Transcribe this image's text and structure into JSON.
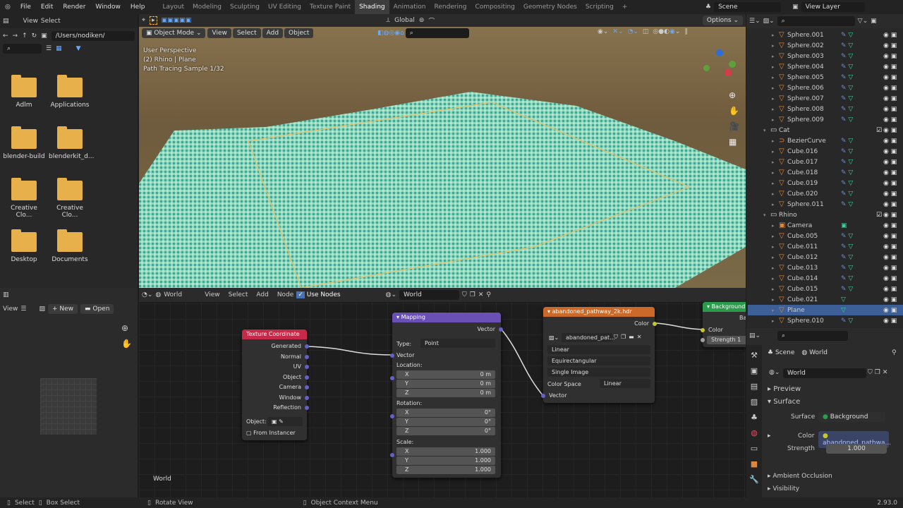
{
  "menus": [
    "File",
    "Edit",
    "Render",
    "Window",
    "Help"
  ],
  "workspaces": [
    "Layout",
    "Modeling",
    "Sculpting",
    "UV Editing",
    "Texture Paint",
    "Shading",
    "Animation",
    "Rendering",
    "Compositing",
    "Geometry Nodes",
    "Scripting",
    "+"
  ],
  "active_workspace": "Shading",
  "scene": "Scene",
  "view_layer": "View Layer",
  "filebrowser": {
    "view": "View",
    "select": "Select",
    "path": "/Users/nodiken/",
    "folders": [
      "Adlm",
      "Applications",
      "blender-build",
      "blenderkit_d...",
      "Creative Clo...",
      "Creative Clo...",
      "Desktop",
      "Documents"
    ]
  },
  "viewport": {
    "mode": "Object Mode",
    "menus": [
      "View",
      "Select",
      "Add",
      "Object"
    ],
    "orientation": "Global",
    "options": "Options",
    "overlay_lines": [
      "User Perspective",
      "(2) Rhino | Plane",
      "Path Tracing Sample 1/32"
    ]
  },
  "image_editor": {
    "view": "View",
    "new": "New",
    "open": "Open"
  },
  "node_editor": {
    "world_type": "World",
    "menus": [
      "View",
      "Select",
      "Add",
      "Node"
    ],
    "use_nodes": "Use Nodes",
    "world": "World",
    "corner_label": "World"
  },
  "nodes": {
    "texcoord": {
      "title": "Texture Coordinate",
      "outputs": [
        "Generated",
        "Normal",
        "UV",
        "Object",
        "Camera",
        "Window",
        "Reflection"
      ],
      "object_label": "Object:",
      "from_instancer": "From Instancer"
    },
    "mapping": {
      "title": "Mapping",
      "out": "Vector",
      "type_label": "Type:",
      "type": "Point",
      "vector": "Vector",
      "location": "Location:",
      "rotation": "Rotation:",
      "scale": "Scale:",
      "axes": [
        "X",
        "Y",
        "Z"
      ],
      "loc": [
        "0 m",
        "0 m",
        "0 m"
      ],
      "rot": [
        "0°",
        "0°",
        "0°"
      ],
      "scl": [
        "1.000",
        "1.000",
        "1.000"
      ]
    },
    "image": {
      "title": "abandoned_pathway_2k.hdr",
      "color": "Color",
      "image_name": "abandoned_pat...",
      "interp": "Linear",
      "proj": "Equirectangular",
      "source": "Single Image",
      "cs_label": "Color Space",
      "cs": "Linear",
      "vector": "Vector"
    },
    "background": {
      "title": "Background",
      "out": "Backg",
      "color": "Color",
      "strength": "Strength",
      "strength_val": "1"
    }
  },
  "outliner": [
    {
      "name": "Sphere.001",
      "d": 1,
      "t": "mesh",
      "m": true
    },
    {
      "name": "Sphere.002",
      "d": 1,
      "t": "mesh",
      "m": true
    },
    {
      "name": "Sphere.003",
      "d": 1,
      "t": "mesh",
      "m": true
    },
    {
      "name": "Sphere.004",
      "d": 1,
      "t": "mesh",
      "m": true
    },
    {
      "name": "Sphere.005",
      "d": 1,
      "t": "mesh",
      "m": true
    },
    {
      "name": "Sphere.006",
      "d": 1,
      "t": "mesh",
      "m": true
    },
    {
      "name": "Sphere.007",
      "d": 1,
      "t": "mesh",
      "m": true
    },
    {
      "name": "Sphere.008",
      "d": 1,
      "t": "mesh",
      "m": true
    },
    {
      "name": "Sphere.009",
      "d": 1,
      "t": "mesh",
      "m": true
    },
    {
      "name": "Cat",
      "d": 0,
      "t": "coll"
    },
    {
      "name": "BezierCurve",
      "d": 1,
      "t": "curve",
      "m": true
    },
    {
      "name": "Cube.016",
      "d": 1,
      "t": "mesh",
      "m": true
    },
    {
      "name": "Cube.017",
      "d": 1,
      "t": "mesh",
      "m": true
    },
    {
      "name": "Cube.018",
      "d": 1,
      "t": "mesh",
      "m": true
    },
    {
      "name": "Cube.019",
      "d": 1,
      "t": "mesh",
      "m": true
    },
    {
      "name": "Cube.020",
      "d": 1,
      "t": "mesh",
      "m": true
    },
    {
      "name": "Sphere.011",
      "d": 1,
      "t": "mesh",
      "m": true
    },
    {
      "name": "Rhino",
      "d": 0,
      "t": "coll"
    },
    {
      "name": "Camera",
      "d": 1,
      "t": "camera"
    },
    {
      "name": "Cube.005",
      "d": 1,
      "t": "mesh",
      "m": true
    },
    {
      "name": "Cube.011",
      "d": 1,
      "t": "mesh",
      "m": true
    },
    {
      "name": "Cube.012",
      "d": 1,
      "t": "mesh",
      "m": true
    },
    {
      "name": "Cube.013",
      "d": 1,
      "t": "mesh",
      "m": true
    },
    {
      "name": "Cube.014",
      "d": 1,
      "t": "mesh",
      "m": true
    },
    {
      "name": "Cube.015",
      "d": 1,
      "t": "mesh",
      "m": true
    },
    {
      "name": "Cube.021",
      "d": 1,
      "t": "mesh",
      "m": false
    },
    {
      "name": "Plane",
      "d": 1,
      "t": "mesh",
      "m": false,
      "sel": true
    },
    {
      "name": "Sphere.010",
      "d": 1,
      "t": "mesh",
      "m": true
    }
  ],
  "properties": {
    "scene": "Scene",
    "world_tab": "World",
    "world": "World",
    "preview": "Preview",
    "surface_panel": "Surface",
    "surface_label": "Surface",
    "surface": "Background",
    "color_label": "Color",
    "color": "abandoned_pathwa...",
    "strength_label": "Strength",
    "strength": "1.000",
    "ao": "Ambient Occlusion",
    "visibility": "Visibility"
  },
  "status": {
    "select": "Select",
    "box_select": "Box Select",
    "rotate": "Rotate View",
    "context": "Object Context Menu",
    "version": "2.93.0"
  },
  "colors": {
    "accent": "#4772b3",
    "texcoord_header": "#c52b48",
    "mapping_header": "#6a4fb4",
    "image_header": "#c96a2b",
    "background_header": "#2a9a4b",
    "vector_socket": "#6363c7",
    "color_socket": "#c7c729"
  }
}
